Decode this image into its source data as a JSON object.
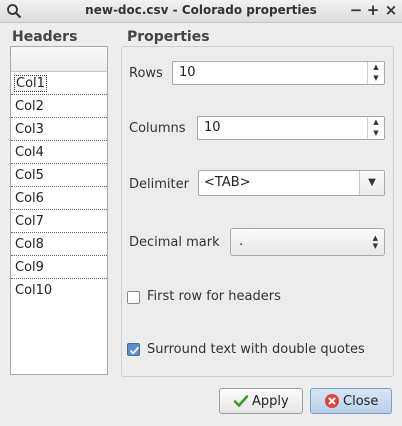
{
  "window": {
    "title": "new-doc.csv - Colorado properties",
    "controls": {
      "minimize": "−",
      "maximize": "+",
      "close": "×"
    }
  },
  "headers": {
    "label": "Headers",
    "items": [
      "Col1",
      "Col2",
      "Col3",
      "Col4",
      "Col5",
      "Col6",
      "Col7",
      "Col8",
      "Col9",
      "Col10"
    ]
  },
  "properties": {
    "label": "Properties",
    "rows": {
      "label": "Rows",
      "value": "10"
    },
    "columns": {
      "label": "Columns",
      "value": "10"
    },
    "delimiter": {
      "label": "Delimiter",
      "value": "<TAB>"
    },
    "decimal_mark": {
      "label": "Decimal mark",
      "value": "."
    },
    "first_row_headers": {
      "label": "First row for headers",
      "checked": false
    },
    "surround_quotes": {
      "label": "Surround text with double quotes",
      "checked": true
    }
  },
  "buttons": {
    "apply": {
      "label": "Apply",
      "icon": "check-icon"
    },
    "close": {
      "label": "Close",
      "icon": "close-circle-icon"
    }
  },
  "colors": {
    "check_green": "#3a9a2a",
    "close_red": "#d9453a",
    "checkbox_blue": "#5b8fc9"
  }
}
